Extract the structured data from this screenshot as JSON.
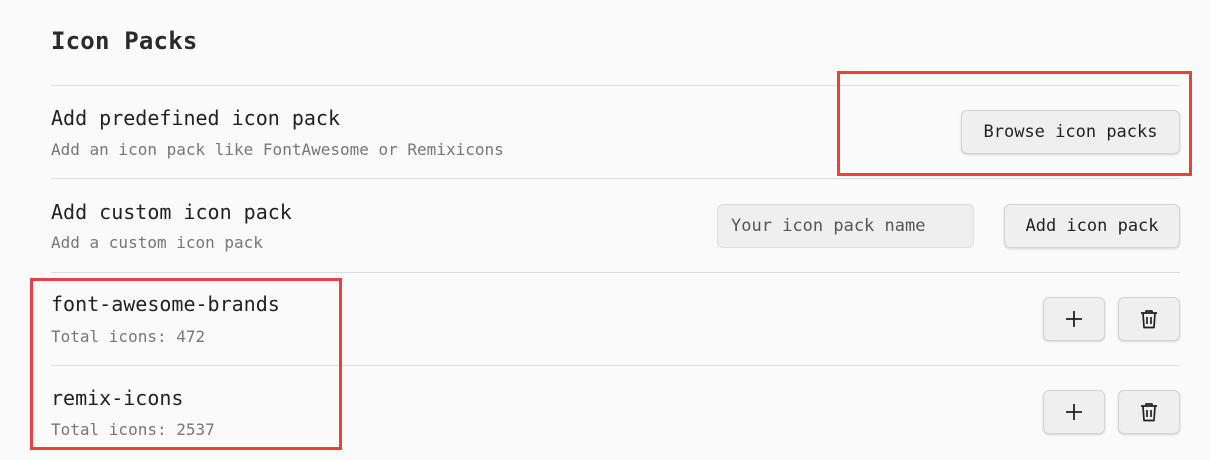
{
  "page": {
    "title": "Icon Packs"
  },
  "predefined": {
    "name": "Add predefined icon pack",
    "description": "Add an icon pack like FontAwesome or Remixicons",
    "button_label": "Browse icon packs"
  },
  "custom": {
    "name": "Add custom icon pack",
    "description": "Add a custom icon pack",
    "input_placeholder": "Your icon pack name",
    "input_value": "",
    "button_label": "Add icon pack"
  },
  "packs": [
    {
      "name": "font-awesome-brands",
      "total_label": "Total icons: 472",
      "icons": [
        "plus-icon",
        "trash-icon"
      ]
    },
    {
      "name": "remix-icons",
      "total_label": "Total icons: 2537",
      "icons": [
        "plus-icon",
        "trash-icon"
      ]
    }
  ],
  "colors": {
    "highlight": "#e8413f",
    "button_bg": "#efefef",
    "divider": "#dcdcdc"
  }
}
